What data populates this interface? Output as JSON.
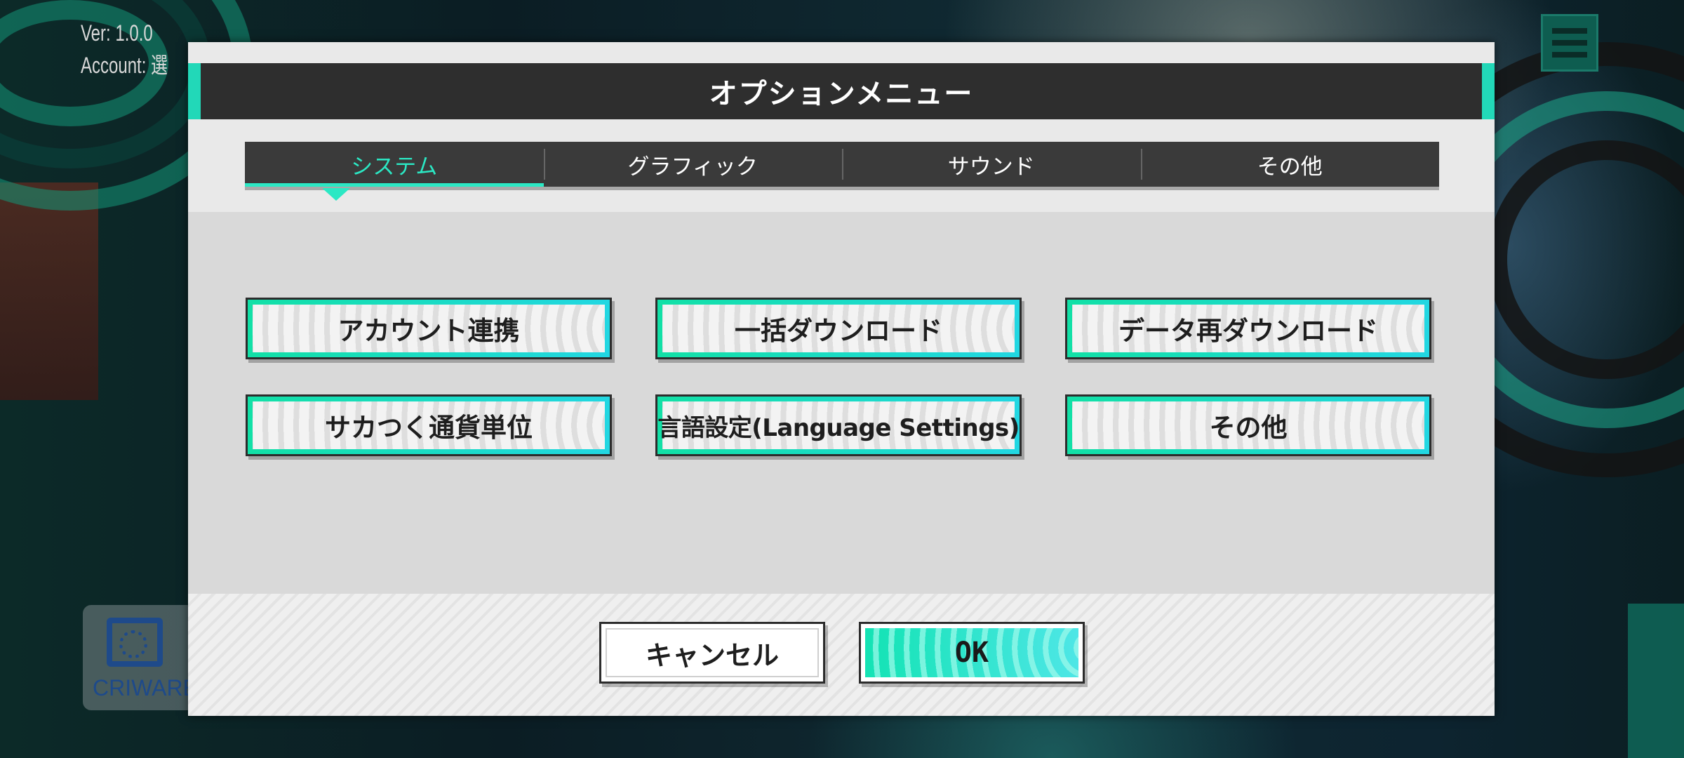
{
  "hud": {
    "version": "Ver: 1.0.0",
    "account": "Account: 選",
    "criware_label": "CRIWARE"
  },
  "dialog": {
    "title": "オプションメニュー",
    "tabs": [
      {
        "label": "システム",
        "active": true
      },
      {
        "label": "グラフィック",
        "active": false
      },
      {
        "label": "サウンド",
        "active": false
      },
      {
        "label": "その他",
        "active": false
      }
    ],
    "options": [
      {
        "label": "アカウント連携"
      },
      {
        "label": "一括ダウンロード"
      },
      {
        "label": "データ再ダウンロード"
      },
      {
        "label": "サカつく通貨単位"
      },
      {
        "label": "言語設定(Language Settings)"
      },
      {
        "label": "その他"
      }
    ],
    "cancel_label": "キャンセル",
    "ok_label": "OK"
  },
  "colors": {
    "accent": "#2be8c4",
    "title_bar": "#2e2e2e",
    "tab_bar": "#3a3a3a"
  }
}
